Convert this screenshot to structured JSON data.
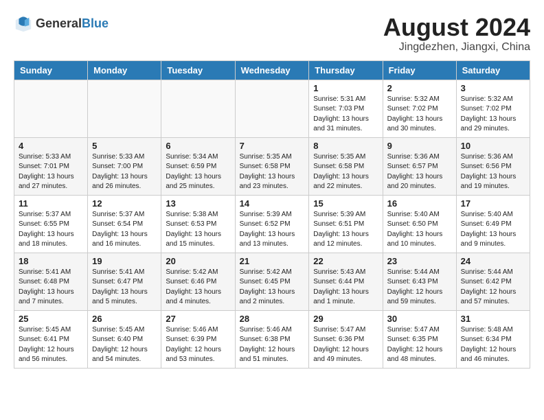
{
  "header": {
    "logo_general": "General",
    "logo_blue": "Blue",
    "month_title": "August 2024",
    "location": "Jingdezhen, Jiangxi, China"
  },
  "weekdays": [
    "Sunday",
    "Monday",
    "Tuesday",
    "Wednesday",
    "Thursday",
    "Friday",
    "Saturday"
  ],
  "weeks": [
    [
      {
        "day": "",
        "info": ""
      },
      {
        "day": "",
        "info": ""
      },
      {
        "day": "",
        "info": ""
      },
      {
        "day": "",
        "info": ""
      },
      {
        "day": "1",
        "info": "Sunrise: 5:31 AM\nSunset: 7:03 PM\nDaylight: 13 hours\nand 31 minutes."
      },
      {
        "day": "2",
        "info": "Sunrise: 5:32 AM\nSunset: 7:02 PM\nDaylight: 13 hours\nand 30 minutes."
      },
      {
        "day": "3",
        "info": "Sunrise: 5:32 AM\nSunset: 7:02 PM\nDaylight: 13 hours\nand 29 minutes."
      }
    ],
    [
      {
        "day": "4",
        "info": "Sunrise: 5:33 AM\nSunset: 7:01 PM\nDaylight: 13 hours\nand 27 minutes."
      },
      {
        "day": "5",
        "info": "Sunrise: 5:33 AM\nSunset: 7:00 PM\nDaylight: 13 hours\nand 26 minutes."
      },
      {
        "day": "6",
        "info": "Sunrise: 5:34 AM\nSunset: 6:59 PM\nDaylight: 13 hours\nand 25 minutes."
      },
      {
        "day": "7",
        "info": "Sunrise: 5:35 AM\nSunset: 6:58 PM\nDaylight: 13 hours\nand 23 minutes."
      },
      {
        "day": "8",
        "info": "Sunrise: 5:35 AM\nSunset: 6:58 PM\nDaylight: 13 hours\nand 22 minutes."
      },
      {
        "day": "9",
        "info": "Sunrise: 5:36 AM\nSunset: 6:57 PM\nDaylight: 13 hours\nand 20 minutes."
      },
      {
        "day": "10",
        "info": "Sunrise: 5:36 AM\nSunset: 6:56 PM\nDaylight: 13 hours\nand 19 minutes."
      }
    ],
    [
      {
        "day": "11",
        "info": "Sunrise: 5:37 AM\nSunset: 6:55 PM\nDaylight: 13 hours\nand 18 minutes."
      },
      {
        "day": "12",
        "info": "Sunrise: 5:37 AM\nSunset: 6:54 PM\nDaylight: 13 hours\nand 16 minutes."
      },
      {
        "day": "13",
        "info": "Sunrise: 5:38 AM\nSunset: 6:53 PM\nDaylight: 13 hours\nand 15 minutes."
      },
      {
        "day": "14",
        "info": "Sunrise: 5:39 AM\nSunset: 6:52 PM\nDaylight: 13 hours\nand 13 minutes."
      },
      {
        "day": "15",
        "info": "Sunrise: 5:39 AM\nSunset: 6:51 PM\nDaylight: 13 hours\nand 12 minutes."
      },
      {
        "day": "16",
        "info": "Sunrise: 5:40 AM\nSunset: 6:50 PM\nDaylight: 13 hours\nand 10 minutes."
      },
      {
        "day": "17",
        "info": "Sunrise: 5:40 AM\nSunset: 6:49 PM\nDaylight: 13 hours\nand 9 minutes."
      }
    ],
    [
      {
        "day": "18",
        "info": "Sunrise: 5:41 AM\nSunset: 6:48 PM\nDaylight: 13 hours\nand 7 minutes."
      },
      {
        "day": "19",
        "info": "Sunrise: 5:41 AM\nSunset: 6:47 PM\nDaylight: 13 hours\nand 5 minutes."
      },
      {
        "day": "20",
        "info": "Sunrise: 5:42 AM\nSunset: 6:46 PM\nDaylight: 13 hours\nand 4 minutes."
      },
      {
        "day": "21",
        "info": "Sunrise: 5:42 AM\nSunset: 6:45 PM\nDaylight: 13 hours\nand 2 minutes."
      },
      {
        "day": "22",
        "info": "Sunrise: 5:43 AM\nSunset: 6:44 PM\nDaylight: 13 hours\nand 1 minute."
      },
      {
        "day": "23",
        "info": "Sunrise: 5:44 AM\nSunset: 6:43 PM\nDaylight: 12 hours\nand 59 minutes."
      },
      {
        "day": "24",
        "info": "Sunrise: 5:44 AM\nSunset: 6:42 PM\nDaylight: 12 hours\nand 57 minutes."
      }
    ],
    [
      {
        "day": "25",
        "info": "Sunrise: 5:45 AM\nSunset: 6:41 PM\nDaylight: 12 hours\nand 56 minutes."
      },
      {
        "day": "26",
        "info": "Sunrise: 5:45 AM\nSunset: 6:40 PM\nDaylight: 12 hours\nand 54 minutes."
      },
      {
        "day": "27",
        "info": "Sunrise: 5:46 AM\nSunset: 6:39 PM\nDaylight: 12 hours\nand 53 minutes."
      },
      {
        "day": "28",
        "info": "Sunrise: 5:46 AM\nSunset: 6:38 PM\nDaylight: 12 hours\nand 51 minutes."
      },
      {
        "day": "29",
        "info": "Sunrise: 5:47 AM\nSunset: 6:36 PM\nDaylight: 12 hours\nand 49 minutes."
      },
      {
        "day": "30",
        "info": "Sunrise: 5:47 AM\nSunset: 6:35 PM\nDaylight: 12 hours\nand 48 minutes."
      },
      {
        "day": "31",
        "info": "Sunrise: 5:48 AM\nSunset: 6:34 PM\nDaylight: 12 hours\nand 46 minutes."
      }
    ]
  ]
}
